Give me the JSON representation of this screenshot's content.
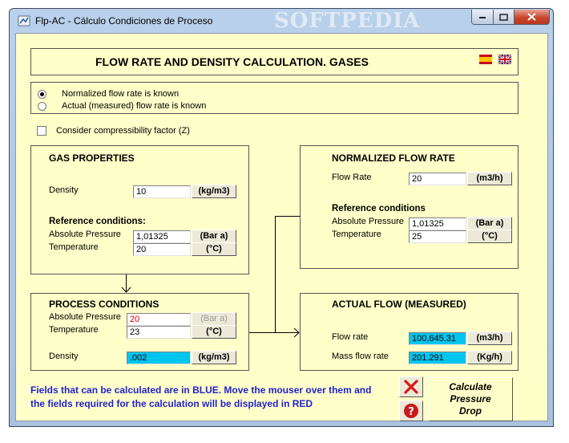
{
  "window": {
    "title": "Flp-AC - Cálculo Condiciones de Proceso",
    "watermark": "SOFTPEDIA"
  },
  "header": {
    "title": "FLOW RATE AND DENSITY CALCULATION. GASES",
    "flags": [
      "spain-flag-icon",
      "uk-flag-icon"
    ]
  },
  "mode": {
    "options": [
      "Normalized flow rate is known",
      "Actual (measured) flow rate is known"
    ],
    "selected_index": 0,
    "compressibility_label": "Consider compressibility factor (Z)",
    "compressibility_checked": false
  },
  "gas_properties": {
    "title": "GAS PROPERTIES",
    "density_label": "Density",
    "density_value": "10",
    "density_unit": "(kg/m3)",
    "ref_title": "Reference conditions:",
    "abs_pressure_label": "Absolute Pressure",
    "abs_pressure_value": "1,01325",
    "abs_pressure_unit": "(Bar a)",
    "temperature_label": "Temperature",
    "temperature_value": "20",
    "temperature_unit": "(°C)"
  },
  "process_conditions": {
    "title": "PROCESS CONDITIONS",
    "abs_pressure_label": "Absolute Pressure",
    "abs_pressure_value": "20",
    "abs_pressure_unit": "(Bar a)",
    "temperature_label": "Temperature",
    "temperature_value": "23",
    "temperature_unit": "(°C)",
    "density_label": "Density",
    "density_value": ".002",
    "density_unit": "(kg/m3)"
  },
  "normalized_flow": {
    "title": "NORMALIZED FLOW RATE",
    "flow_label": "Flow Rate",
    "flow_value": "20",
    "flow_unit": "(m3/h)",
    "ref_title": "Reference conditions",
    "abs_pressure_label": "Absolute Pressure",
    "abs_pressure_value": "1,01325",
    "abs_pressure_unit": "(Bar a)",
    "temperature_label": "Temperature",
    "temperature_value": "25",
    "temperature_unit": "(°C)"
  },
  "actual_flow": {
    "title": "ACTUAL FLOW (MEASURED)",
    "flow_label": "Flow rate",
    "flow_value": "100,645.31",
    "flow_unit": "(m3/h)",
    "mass_label": "Mass flow rate",
    "mass_value": "201.291",
    "mass_unit": "(Kg/h)"
  },
  "footer": {
    "help_text": "Fields that can be calculated are in BLUE. Move the mouser over them and the fields required for the calculation will be displayed in RED",
    "calc_button": "Calculate Pressure Drop"
  },
  "colors": {
    "panel_bg": "#ffffc9",
    "calculated_field": "#00c5ee",
    "required_text": "#e00000",
    "help_text": "#1f1fd0"
  }
}
